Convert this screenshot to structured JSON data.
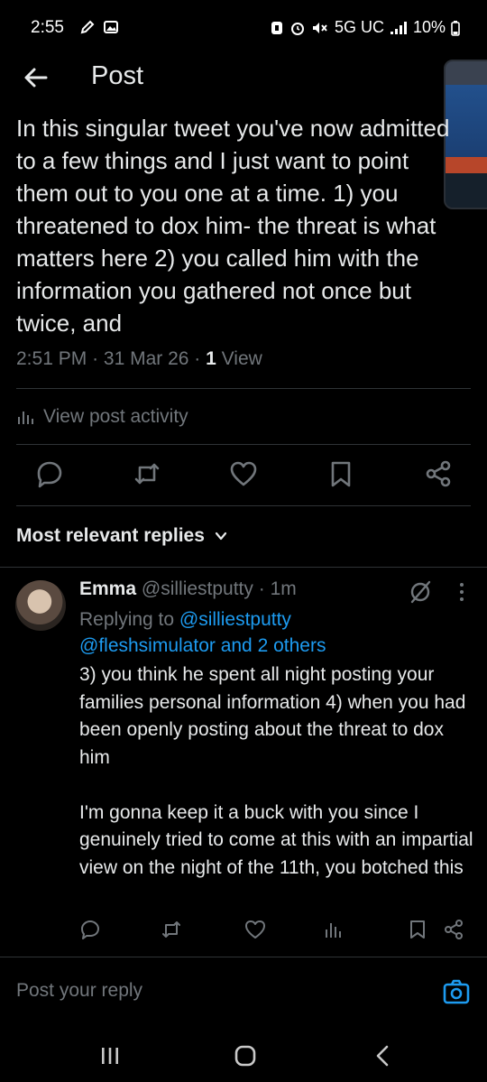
{
  "status_bar": {
    "time": "2:55",
    "network": "5G UC",
    "battery": "10%",
    "icons": [
      "pen-icon",
      "image-icon",
      "bixby-icon",
      "alarm-icon",
      "mute-icon",
      "signal-icon",
      "battery-icon"
    ]
  },
  "header": {
    "title": "Post",
    "back_icon": "arrow-left-icon"
  },
  "tweet": {
    "text": "In this singular tweet you've now admitted to a few things and I just want to point them out to you one at a time. 1) you threatened to dox him- the threat is what matters here 2) you called him with the information you gathered not once but twice, and",
    "time": "2:51 PM",
    "date": "31 Mar 26",
    "view_count": "1",
    "view_label": "View",
    "activity_label": "View post activity"
  },
  "tweet_actions": [
    "reply-icon",
    "retweet-icon",
    "like-icon",
    "bookmark-icon",
    "share-icon"
  ],
  "replies_filter": {
    "label": "Most relevant replies"
  },
  "reply": {
    "name": "Emma",
    "handle": "@silliestputty",
    "age": "1m",
    "replying_prefix": "Replying to",
    "replying_to_1": "@silliestputty",
    "replying_to_2": "@fleshsimulator and 2 others",
    "text": "3) you think he spent all night posting your families personal information 4) when you had been openly posting about the threat to dox him\n\nI'm gonna keep it a buck with you since I genuinely tried to come at this with an impartial view on the night of the 11th, you botched this"
  },
  "composer": {
    "placeholder": "Post your reply"
  },
  "colors": {
    "background": "#000000",
    "text": "#e7e9ea",
    "muted": "#71767b",
    "link": "#1d9bf0",
    "divider": "#2f3336"
  }
}
